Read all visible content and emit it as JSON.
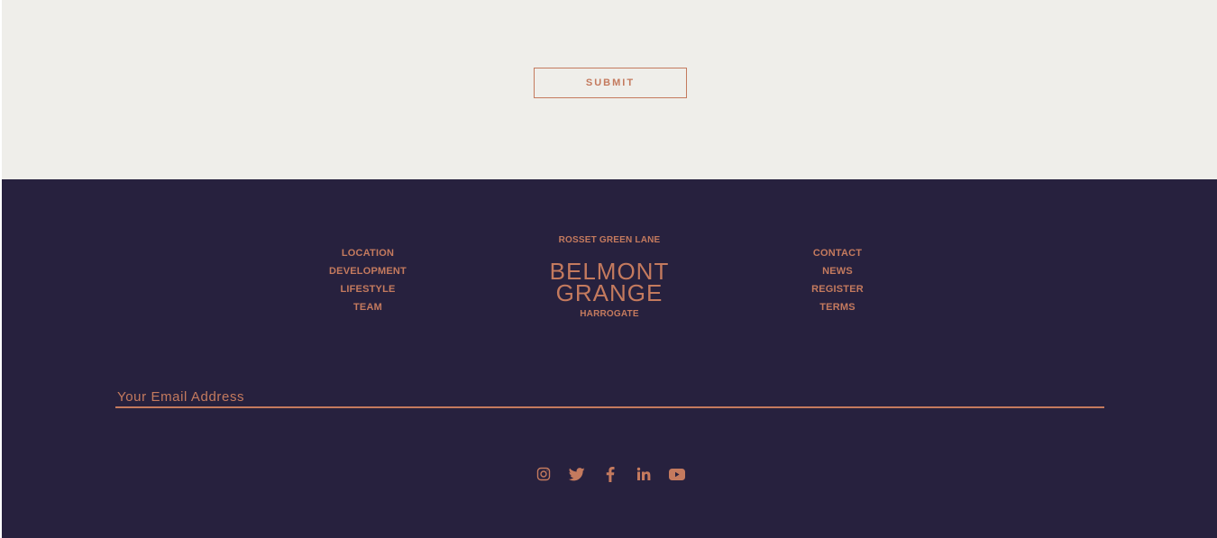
{
  "form": {
    "submit_label": "SUBMIT"
  },
  "footer": {
    "nav_left": [
      {
        "label": "LOCATION"
      },
      {
        "label": "DEVELOPMENT"
      },
      {
        "label": "LIFESTYLE"
      },
      {
        "label": "TEAM"
      }
    ],
    "brand": {
      "street": "ROSSET GREEN LANE",
      "name_line1": "BELMONT",
      "name_line2": "GRANGE",
      "town": "HARROGATE"
    },
    "nav_right": [
      {
        "label": "CONTACT"
      },
      {
        "label": "NEWS"
      },
      {
        "label": "REGISTER"
      },
      {
        "label": "TERMS"
      }
    ],
    "email_placeholder": "Your Email Address",
    "social_icons": [
      "instagram-icon",
      "twitter-icon",
      "facebook-icon",
      "linkedin-icon",
      "youtube-icon"
    ]
  },
  "colors": {
    "accent": "#c47a5e",
    "footer_background": "#27213e",
    "page_background": "#efeeea"
  }
}
